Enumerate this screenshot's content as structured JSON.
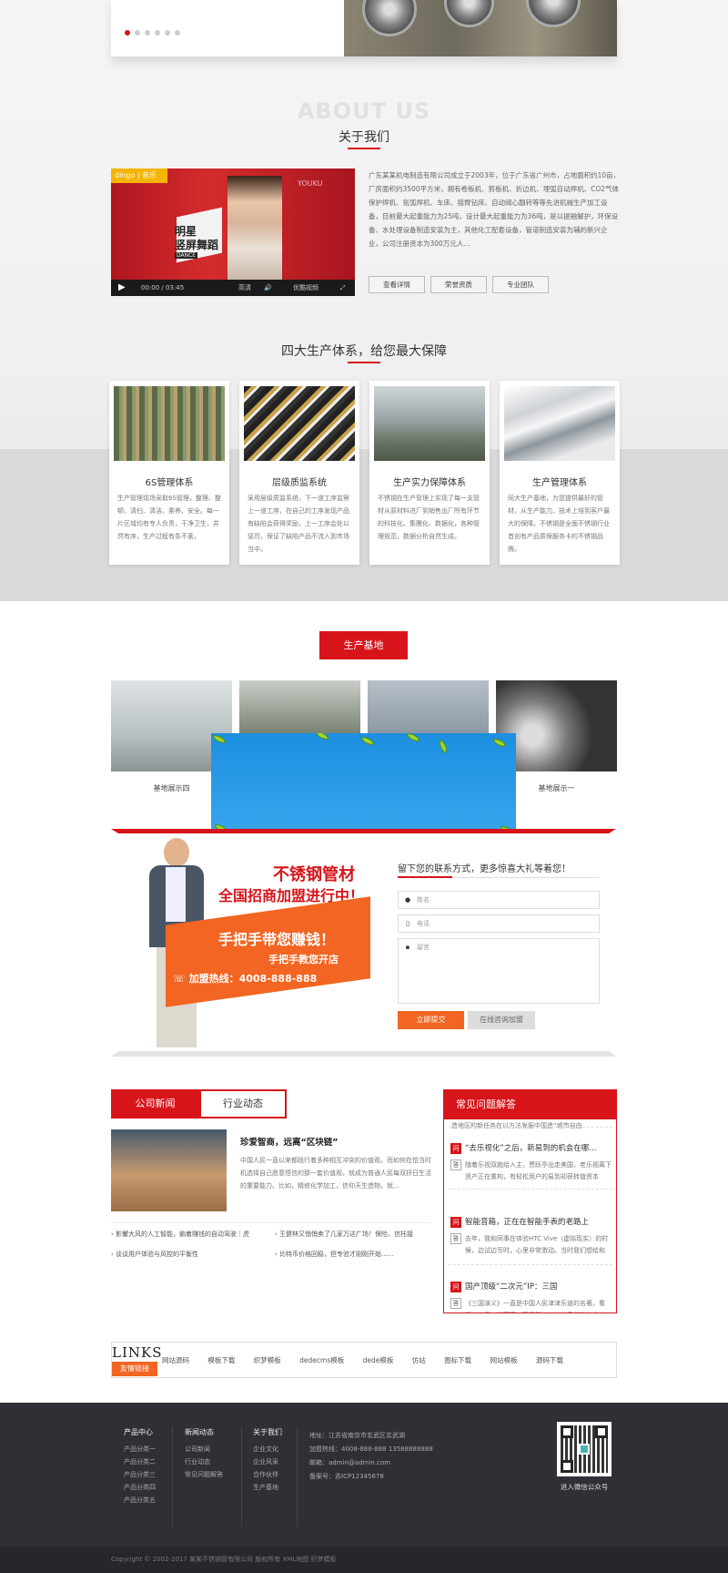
{
  "slider": {
    "dots": 6,
    "active": 0
  },
  "about": {
    "ghost": "ABOUT US",
    "title": "关于我们",
    "text": "广东某某机电制造有限公司成立于2003年，位于广东省广州市，占地面积约10亩，厂房面积约3500平方米，拥有卷板机、剪板机、折边机、埋弧自动焊机、CO2气体保护焊机、氩弧焊机、车床、摇臂钻床、自动阀心翻转等等先进机械生产加工设备，目前最大起重能力为25吨，设计最大起重能力为36吨，是以提融解护，环保设备、水处理设备制造安装为主，其他化工配套设备，管道制造安装为辅的新兴企业，公司注册资本为300万元人...",
    "video": {
      "logo": "dingo | 音乐",
      "sign1": "明星",
      "sign2": "竖屏舞蹈",
      "sign3": "DANCE",
      "time": "00:00 / 03:45",
      "quality": "高清",
      "quality2": "优酷视频",
      "youku": "YOUKU"
    },
    "buttons": [
      "查看详情",
      "荣誉资质",
      "专业团队"
    ]
  },
  "system": {
    "title": "四大生产体系，给您最大保障",
    "cards": [
      {
        "title": "6S管理体系",
        "desc": "生产管理现场采取6S管理，整理、整顿、清扫、清洁、素养、安全。每一片区域均有专人负责，干净卫生，井然有序，生产过程有条不紊。"
      },
      {
        "title": "层级质监系统",
        "desc": "采用层级质监系统，下一道工序监察上一道工序，在自己的工序发现产品有缺陷会获得奖励，上一工序会处以惩罚，保证了缺陷产品不流入到市场当中。"
      },
      {
        "title": "生产实力保障体系",
        "desc": "不锈钢在生产管理上实现了每一支管材从原材料进厂到销售出厂所有环节的科技化、集團化、数据化，各种管理规范，数据分析自然生成。"
      },
      {
        "title": "生产管理体系",
        "desc": "同大生产基地，为您提供最好的管材，从生产能力、技术上培到客户最大的保障。不锈钢是全面不锈钢行业首创有产品质保服务卡的不锈钢品牌。"
      }
    ]
  },
  "base": {
    "button": "生产基地",
    "captions": [
      "基地展示四",
      "",
      "",
      "基地展示一"
    ]
  },
  "join": {
    "headline1": "不锈钢管材",
    "headline2": "全国招商加盟进行中！",
    "banner1": "手把手带您赚钱！",
    "banner2": "手把手教您开店",
    "hotline": "加盟热线：4008-888-888",
    "form_title": "留下您的联系方式，更多惊喜大礼等着您！",
    "name_ph": "姓名",
    "phone_ph": "电话",
    "msg_ph": "留言",
    "submit": "立即提交",
    "online": "在线咨询加盟"
  },
  "news": {
    "tab_active": "公司新闻",
    "tab_other": "行业动态",
    "headline": "珍爱智商，远离“区块链”",
    "summary": "中国人民一直以来都践行着多种相互冲突的价值观，而如何在恰当时机选择自己愿意悟信的那一套价值观，就成为普通人民每双抒日生活的重要能力。比如，精修化学加工，信仰天生造物，就...",
    "items": [
      "影響大风的人工智能，躺着赚钱的自动驾驶｜虎",
      "王健林又悄悄卖了几家万达广场！保险、信托接",
      "谈谈用户体验与风控的平衡性",
      "比特币价格回稳，但专验才刚刚开始......"
    ]
  },
  "faq": {
    "title": "常见问题解答",
    "top_cut": "造地区的新任务在以方法发服中国造“城市自由",
    "items": [
      {
        "q": "“去乐视化”之后，新易到的机会在哪...",
        "a": "随着乐视双跑给入主，贾跃亭出走美国，老乐视离下资产正在重构，有轻松用户的易到却获转值资本"
      },
      {
        "q": "智能音箱，正在在智能手表的老路上",
        "a": "去年，我和同事在体验HTC Vive（虚拟现实）的时候，边试边写时，心里非常激动。当时我们想给和"
      },
      {
        "q": "国产顶级“二次元”IP：三国",
        "a": "《三国演义》一直是中国人民津津乐道的名著。看播、刘备、诸葛亮、司马懿……这一系若的名字"
      }
    ]
  },
  "links": {
    "title": "LINKS",
    "subtitle": "友情链接",
    "items": [
      "网站源码",
      "模板下载",
      "织梦模板",
      "dedecms模板",
      "dede模板",
      "仿站",
      "图标下载",
      "网站模板",
      "源码下载"
    ]
  },
  "footer": {
    "cols": [
      {
        "head": "产品中心",
        "items": [
          "产品分类一",
          "产品分类二",
          "产品分类三",
          "产品分类四",
          "产品分类五"
        ]
      },
      {
        "head": "新闻动态",
        "items": [
          "公司新闻",
          "行业动态",
          "常见问题解答"
        ]
      },
      {
        "head": "关于我们",
        "items": [
          "企业文化",
          "企业风采",
          "合作伙伴",
          "生产基地"
        ]
      }
    ],
    "contact": [
      "地址：江苏省南京市玄武区玄武湖",
      "加盟热线：4008-888-888    13588888888",
      "邮箱：admin@admin.com",
      "备案号：苏ICP12345678"
    ],
    "qr_caption": "进入微信公众号",
    "copyright": "Copyright © 2002-2017 某某不锈钢管有限公司 版权所有    XML地图    织梦模板"
  },
  "colors": {
    "accent": "#d7141a",
    "footer": "#2f3035"
  }
}
